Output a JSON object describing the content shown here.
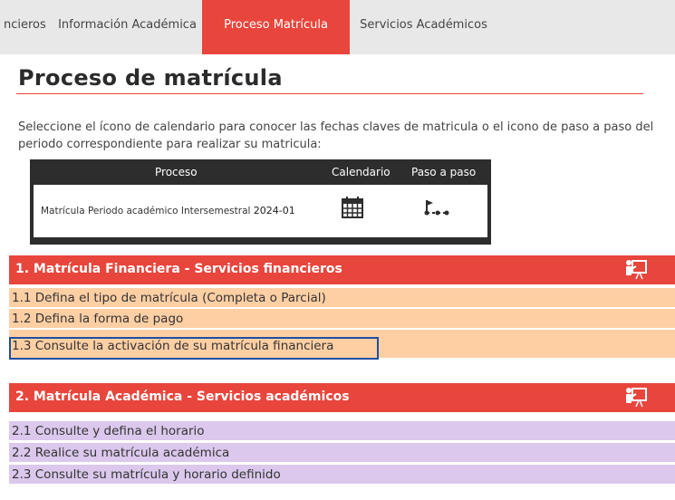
{
  "tabs": [
    {
      "label": "ncieros",
      "bar": "#6b3fa0"
    },
    {
      "label": "Información Académica",
      "bar": "#6b3fa0"
    },
    {
      "label": "Proceso Matrícula",
      "bar": "#e8453c"
    },
    {
      "label": "Servicios Académicos",
      "bar": "#8a7560"
    }
  ],
  "page": {
    "title": "Proceso de matrícula",
    "intro": "Seleccione el ícono de calendario para conocer las fechas claves de matricula o el icono de paso a paso del periodo correspondiente para realizar su matricula:"
  },
  "table": {
    "headers": {
      "proceso": "Proceso",
      "calendario": "Calendario",
      "paso": "Paso a paso"
    },
    "row": {
      "proceso": "Matrícula Periodo académico Intersemestral",
      "periodo": "2024-01",
      "calendar_icon": "calendar-icon",
      "steps_icon": "steps-icon"
    }
  },
  "sections": [
    {
      "title": "1. Matrícula Financiera - Servicios financieros",
      "icon": "presentation-icon",
      "items": [
        "1.1 Defina el tipo de matrícula (Completa o Parcial)",
        "1.2 Defina la forma de pago",
        "1.3 Consulte la activación de su matrícula financiera"
      ]
    },
    {
      "title": "2. Matrícula Académica - Servicios académicos",
      "icon": "presentation-icon",
      "items": [
        "2.1 Consulte y defina el horario",
        "2.2 Realice su matrícula académica",
        "2.3 Consulte su matrícula y horario definido"
      ]
    }
  ],
  "colors": {
    "accent": "#e8453c",
    "financial_row": "#ffcfa4",
    "academic_row": "#dbc8ec",
    "highlight": "#1f4fa0"
  }
}
